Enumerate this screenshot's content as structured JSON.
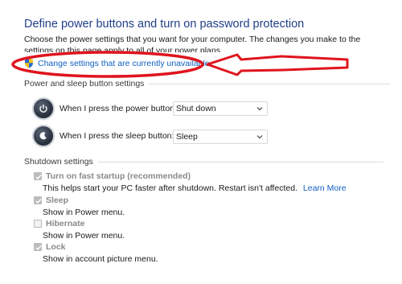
{
  "header": {
    "title": "Define power buttons and turn on password protection",
    "description": "Choose the power settings that you want for your computer. The changes you make to the settings on this page apply to all of your power plans."
  },
  "change_link": {
    "label": "Change settings that are currently unavailable"
  },
  "power_sleep_section": {
    "title": "Power and sleep button settings",
    "rows": [
      {
        "label": "When I press the power button:",
        "value": "Shut down",
        "icon": "power-icon"
      },
      {
        "label": "When I press the sleep button:",
        "value": "Sleep",
        "icon": "sleep-icon"
      }
    ]
  },
  "shutdown_section": {
    "title": "Shutdown settings",
    "options": [
      {
        "label": "Turn on fast startup (recommended)",
        "checked": true,
        "description": "This helps start your PC faster after shutdown. Restart isn't affected.",
        "link": "Learn More"
      },
      {
        "label": "Sleep",
        "checked": true,
        "description": "Show in Power menu."
      },
      {
        "label": "Hibernate",
        "checked": false,
        "description": "Show in Power menu."
      },
      {
        "label": "Lock",
        "checked": true,
        "description": "Show in account picture menu."
      }
    ]
  },
  "colors": {
    "title": "#1f3f86",
    "link": "#1060c2",
    "annotation": "#e0141e"
  }
}
